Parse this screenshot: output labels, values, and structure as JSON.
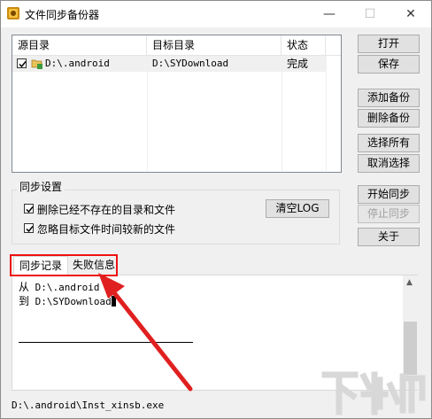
{
  "window": {
    "title": "文件同步备份器",
    "controls": {
      "minimize": "—",
      "maximize": "☐",
      "close": "✕"
    }
  },
  "list": {
    "columns": [
      "源目录",
      "目标目录",
      "状态"
    ],
    "rows": [
      {
        "checked": true,
        "source": "D:\\.android",
        "target": "D:\\SYDownload",
        "status": "完成"
      }
    ]
  },
  "buttons": {
    "open": "打开",
    "save": "保存",
    "add_backup": "添加备份",
    "delete_backup": "删除备份",
    "select_all": "选择所有",
    "deselect": "取消选择",
    "start_sync": "开始同步",
    "stop_sync": "停止同步",
    "about": "关于",
    "clear_log": "清空LOG"
  },
  "sync_settings": {
    "label": "同步设置",
    "options": [
      {
        "label": "删除已经不存在的目录和文件",
        "checked": true
      },
      {
        "label": "忽略目标文件时间较新的文件",
        "checked": true
      }
    ]
  },
  "tabs": [
    "同步记录",
    "失败信息"
  ],
  "log": {
    "lines": [
      {
        "prefix": "从",
        "path": "D:\\.android"
      },
      {
        "prefix": "到",
        "path": "D:\\SYDownload"
      }
    ]
  },
  "status_bar": "D:\\.android\\Inst_xinsb.exe",
  "watermark": "下载吧",
  "colors": {
    "highlight": "#ee1111",
    "arrow": "#e02020"
  }
}
